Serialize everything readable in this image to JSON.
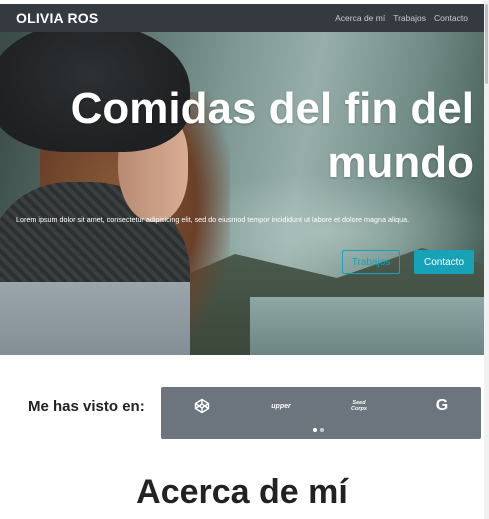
{
  "navbar": {
    "brand": "OLIVIA ROS",
    "links": [
      {
        "label": "Acerca de mí"
      },
      {
        "label": "Trabajos"
      },
      {
        "label": "Contacto"
      }
    ]
  },
  "hero": {
    "title_line1": "Comidas del fin del",
    "title_line2": "mundo",
    "text": "Lorem ipsum dolor sit amet, consectetur adipisicing elit, sed do eiusmod tempor incididunt ut labore et dolore magna aliqua.",
    "btn_works": "Trabajos",
    "btn_contact": "Contacto"
  },
  "seen": {
    "label": "Me has visto en:",
    "logos": [
      {
        "name": "codepen-icon",
        "text": "⬡"
      },
      {
        "name": "upper-logo",
        "text": "upper"
      },
      {
        "name": "script-logo",
        "text": "Seed Corps"
      },
      {
        "name": "google-icon",
        "text": "G"
      }
    ],
    "active_slide": 1,
    "slide_count": 2
  },
  "about": {
    "title": "Acerca de mí"
  },
  "colors": {
    "navbar": "#343a40",
    "accent": "#17a2b8",
    "logos_bg": "#6c757d"
  }
}
